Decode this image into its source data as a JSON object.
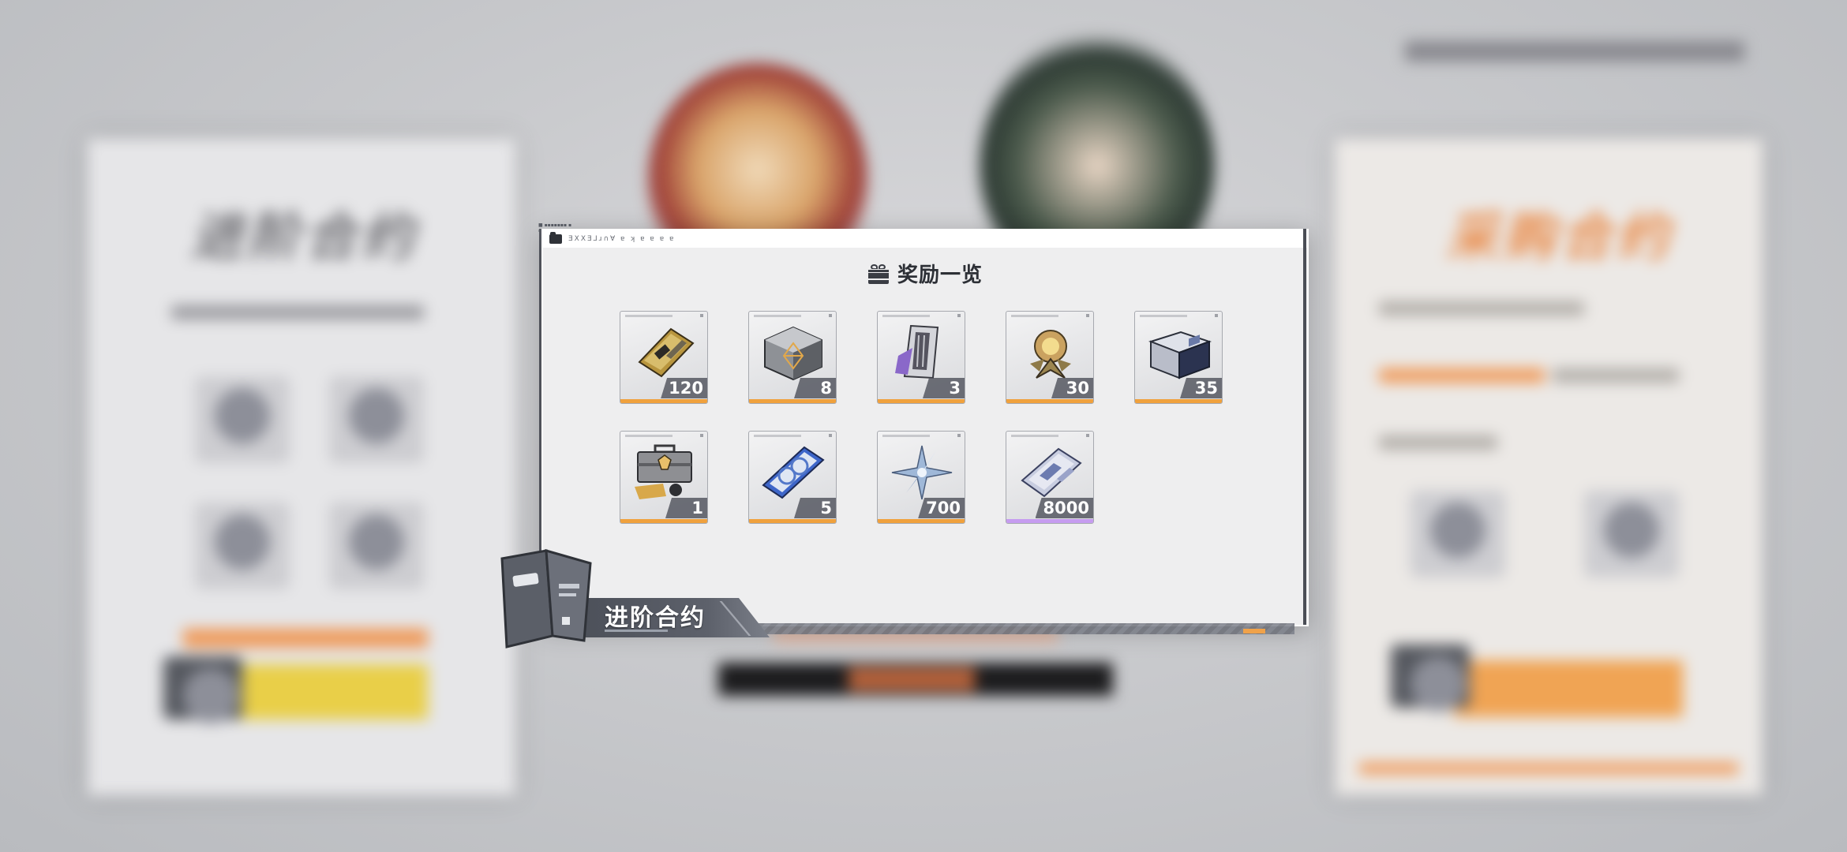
{
  "background": {
    "left_panel_title": "进阶合约",
    "right_panel_title": "采购合约"
  },
  "window": {
    "titlebar_text": "ƎXXƎ⅃ɹ∩Ɐ ɐ ʞ ɐ ɐ ɐ ɐ",
    "header_title": "奖励一览"
  },
  "rewards": [
    {
      "count": "120",
      "rarity": "orange"
    },
    {
      "count": "8",
      "rarity": "orange"
    },
    {
      "count": "3",
      "rarity": "orange"
    },
    {
      "count": "30",
      "rarity": "orange"
    },
    {
      "count": "35",
      "rarity": "orange"
    },
    {
      "count": "1",
      "rarity": "orange"
    },
    {
      "count": "5",
      "rarity": "orange"
    },
    {
      "count": "700",
      "rarity": "orange"
    },
    {
      "count": "8000",
      "rarity": "purple"
    }
  ],
  "banner": {
    "title": "进阶合约"
  },
  "colors": {
    "rarity_orange": "#f0a13d",
    "rarity_purple": "#c69cf0",
    "count_badge": "#565862",
    "accent_orange": "#ef9a5a"
  }
}
